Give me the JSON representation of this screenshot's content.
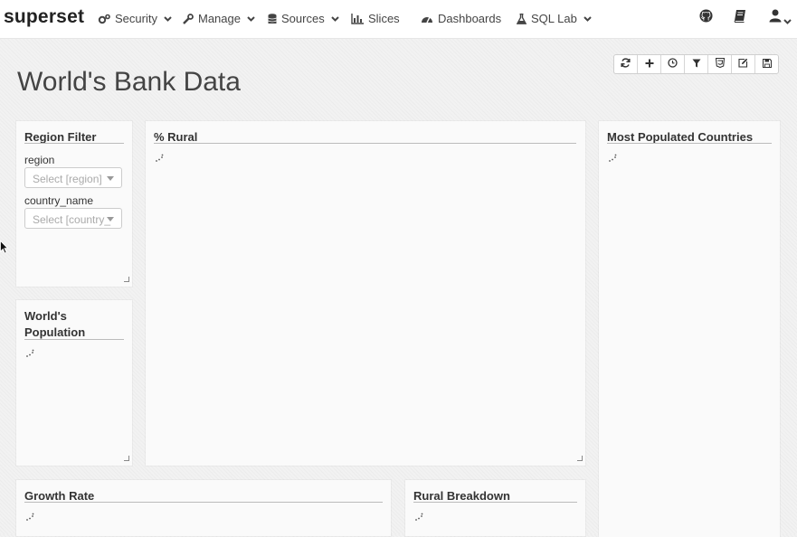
{
  "brand": "superset",
  "nav": {
    "security": "Security",
    "manage": "Manage",
    "sources": "Sources",
    "slices": "Slices",
    "dashboards": "Dashboards",
    "sql_lab": "SQL Lab"
  },
  "right_icons": [
    "github-icon",
    "book-icon",
    "user-icon"
  ],
  "dashboard": {
    "title": "World's Bank Data",
    "controls": [
      "refresh-icon",
      "plus-icon",
      "clock-icon",
      "filter-icon",
      "css-icon",
      "edit-icon",
      "save-icon"
    ]
  },
  "panels": {
    "region_filter": {
      "title": "Region Filter",
      "region_label": "region",
      "region_placeholder": "Select [region]",
      "country_label": "country_name",
      "country_placeholder": "Select [country_"
    },
    "rural": {
      "title": "% Rural"
    },
    "most_populated": {
      "title": "Most Populated Countries"
    },
    "world_population": {
      "title_line1": "World's",
      "title_line2": "Population"
    },
    "growth_rate": {
      "title": "Growth Rate"
    },
    "rural_breakdown": {
      "title": "Rural Breakdown"
    }
  }
}
